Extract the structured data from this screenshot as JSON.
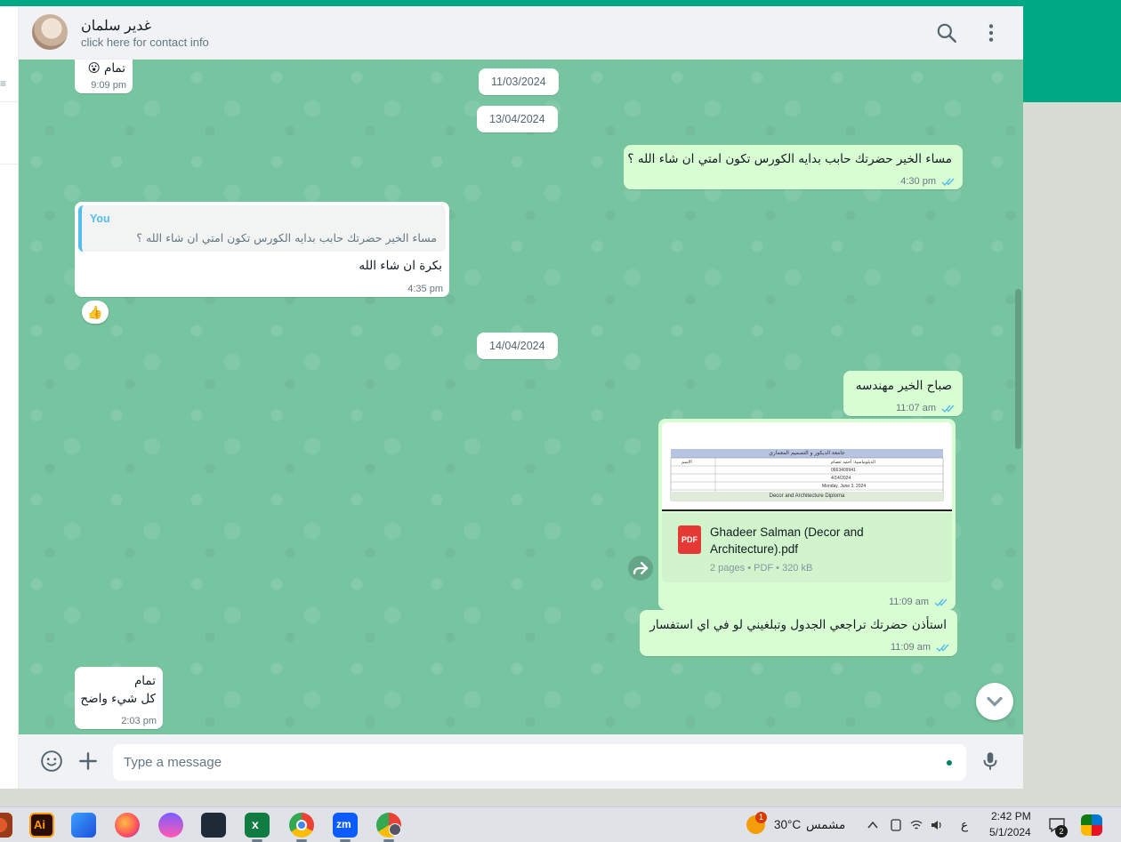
{
  "header": {
    "contact_name": "غدير سلمان",
    "contact_subtitle": "click here for contact info"
  },
  "messages": {
    "top_partial": {
      "text": "تمام 😮",
      "time": "9:09 pm"
    },
    "dates": [
      "11/03/2024",
      "13/04/2024",
      "14/04/2024"
    ],
    "m1": {
      "text": "مساء الخير حضرتك حابب بدايه الكورس تكون امتي ان شاء الله ؟",
      "time": "4:30 pm"
    },
    "m2": {
      "quote_author": "You",
      "quote_text": "مساء الخير حضرتك حابب بدايه الكورس تكون امتي ان شاء الله ؟",
      "text": "بكرة ان شاء الله",
      "time": "4:35 pm",
      "reaction": "👍"
    },
    "m3": {
      "text": "صباح الخير مهندسه",
      "time": "11:07 am"
    },
    "m4": {
      "file_name": "Ghadeer Salman (Decor and Architecture).pdf",
      "file_meta": "2 pages • PDF • 320 kB",
      "file_type": "PDF",
      "time": "11:09 am",
      "preview": {
        "title": "جامعة الديكور و التصميم المعماري",
        "rows": [
          "الدبلوماسية: أحمد عصام",
          "الاسم",
          "0663409941",
          "4/14/2024",
          "Monday, June 3, 2024"
        ],
        "subtitle": "Decor and Architecture Diploma"
      }
    },
    "m5": {
      "text": "استأذن حضرتك تراجعي الجدول وتبلغيني لو في اي استفسار",
      "time": "11:09 am"
    },
    "m6": {
      "line1": "تمام",
      "line2": "كل شيء واضح",
      "time": "2:03 pm"
    }
  },
  "composer": {
    "placeholder": "Type a message"
  },
  "taskbar": {
    "weather_temp": "30°C",
    "weather_text": "مشمس",
    "weather_badge": "1",
    "lang": "ع",
    "time": "2:42 PM",
    "date": "5/1/2024",
    "notif_count": "2"
  },
  "colors": {
    "accent": "#00a884",
    "outgoing_bubble": "#d9fdd3",
    "incoming_bubble": "#ffffff",
    "read_ticks": "#53bdeb",
    "wallpaper": "#77c4a0"
  }
}
